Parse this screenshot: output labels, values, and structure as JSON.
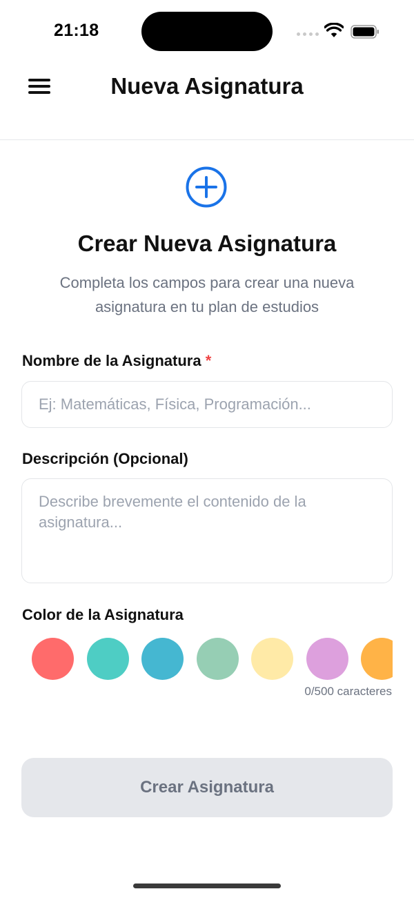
{
  "status_bar": {
    "time": "21:18"
  },
  "nav": {
    "title": "Nueva Asignatura",
    "menu_icon": "hamburger-menu-icon"
  },
  "header": {
    "icon": "plus-circle-icon",
    "title": "Crear Nueva Asignatura",
    "subtitle": "Completa los campos para crear una nueva asignatura en tu plan de estudios"
  },
  "form": {
    "name": {
      "label": "Nombre de la Asignatura",
      "required_mark": "*",
      "placeholder": "Ej: Matemáticas, Física, Programación...",
      "value": ""
    },
    "description": {
      "label": "Descripción (Opcional)",
      "placeholder": "Describe brevemente el contenido de la asignatura...",
      "value": ""
    },
    "color": {
      "label": "Color de la Asignatura",
      "options": [
        "#FF6B6B",
        "#4ECDC4",
        "#45B7D1",
        "#96CEB4",
        "#FFEAA7",
        "#DDA0DD",
        "#FFB347"
      ]
    },
    "char_counter": "0/500 caracteres",
    "submit_label": "Crear Asignatura"
  },
  "colors": {
    "accent": "#1a73e8",
    "required": "#ef4444",
    "button_disabled_bg": "#e5e7eb"
  }
}
